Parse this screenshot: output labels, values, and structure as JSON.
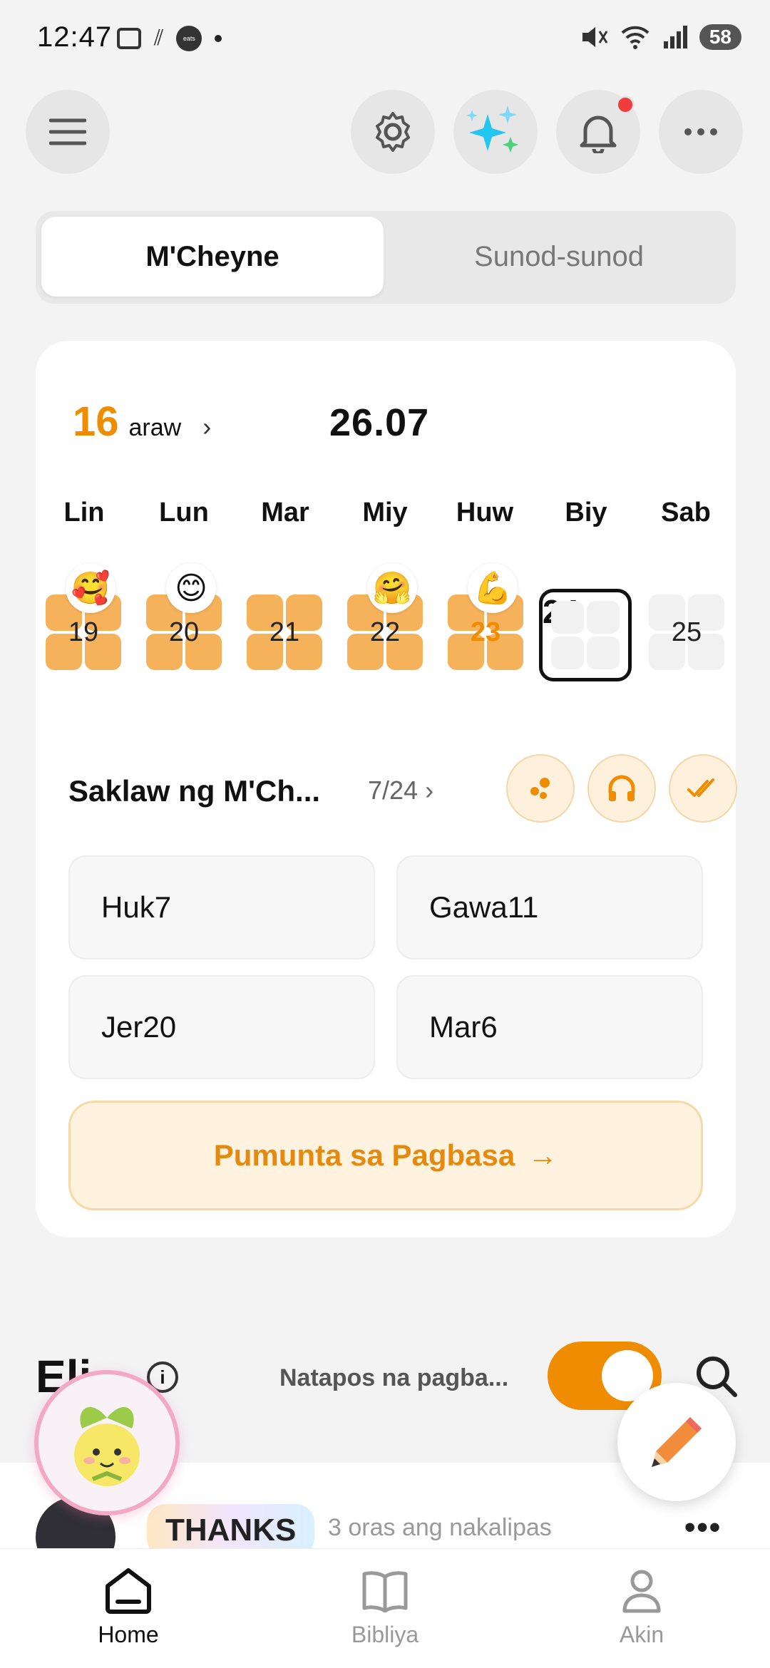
{
  "status_bar": {
    "time": "12:47",
    "battery": "58"
  },
  "tabs": {
    "active": "M'Cheyne",
    "inactive": "Sunod-sunod"
  },
  "streak": {
    "count": "16",
    "label": "araw"
  },
  "date": "26.07",
  "weekdays": [
    "Lin",
    "Lun",
    "Mar",
    "Miy",
    "Huw",
    "Biy",
    "Sab"
  ],
  "days": [
    {
      "num": "19",
      "emoji": "🥰",
      "state": "done"
    },
    {
      "num": "20",
      "emoji": "😊",
      "state": "done"
    },
    {
      "num": "21",
      "emoji": "",
      "state": "done"
    },
    {
      "num": "22",
      "emoji": "🤗",
      "state": "done"
    },
    {
      "num": "23",
      "emoji": "💪",
      "state": "done"
    },
    {
      "num": "24",
      "emoji": "",
      "state": "today"
    },
    {
      "num": "25",
      "emoji": "",
      "state": "future"
    }
  ],
  "range": {
    "title": "Saklaw ng M'Ch...",
    "count": "7/24"
  },
  "books": [
    "Huk7",
    "Gawa11",
    "Jer20",
    "Mar6"
  ],
  "go_button": "Pumunta sa Pagbasa",
  "go_arrow": "→",
  "section": {
    "title": "Eli",
    "finished_label": "Natapos na pagba..."
  },
  "feed": {
    "badge": "THANKS",
    "time_ago": "3 oras ang nakalipas",
    "more": "•••"
  },
  "bottom_nav": [
    {
      "label": "Home",
      "icon": "home-icon",
      "active": true
    },
    {
      "label": "Bibliya",
      "icon": "book-icon",
      "active": false
    },
    {
      "label": "Akin",
      "icon": "person-icon",
      "active": false
    }
  ],
  "colors": {
    "accent": "#f08c00",
    "tile": "#f5b25a",
    "notification": "#f23b3b"
  }
}
